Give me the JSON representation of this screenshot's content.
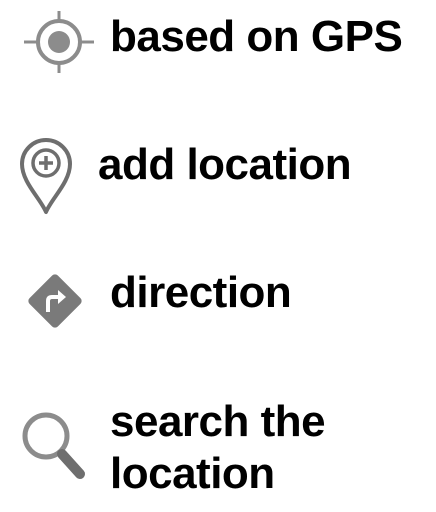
{
  "legend": {
    "items": [
      {
        "icon": "gps-target-icon",
        "label": "based on GPS"
      },
      {
        "icon": "add-location-pin-icon",
        "label": "add location"
      },
      {
        "icon": "direction-sign-icon",
        "label": "direction"
      },
      {
        "icon": "search-magnifier-icon",
        "label": "search the location"
      }
    ]
  },
  "colors": {
    "icon_gray": "#8c8c8c",
    "icon_dark_gray": "#6e6e6e",
    "text": "#000000",
    "background": "#ffffff"
  }
}
